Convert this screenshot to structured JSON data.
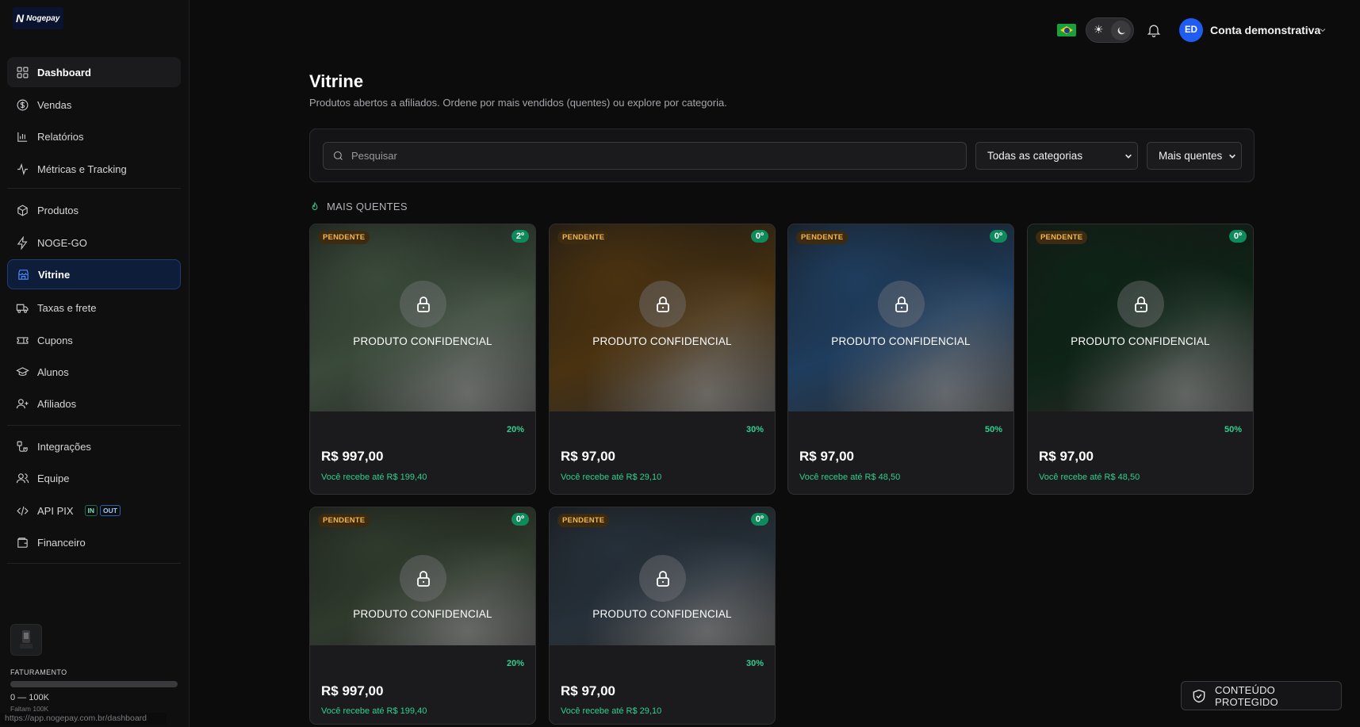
{
  "app": {
    "logo_text": "Nogepay"
  },
  "sidebar": {
    "items": [
      {
        "label": "Dashboard",
        "icon": "grid-icon"
      },
      {
        "label": "Vendas",
        "icon": "dollar-circle-icon"
      },
      {
        "label": "Relatórios",
        "icon": "bar-chart-icon"
      },
      {
        "label": "Métricas e Tracking",
        "icon": "activity-icon"
      },
      {
        "label": "Produtos",
        "icon": "box-icon"
      },
      {
        "label": "NOGE-GO",
        "icon": "zap-icon"
      },
      {
        "label": "Vitrine",
        "icon": "store-icon",
        "active": true
      },
      {
        "label": "Taxas e frete",
        "icon": "truck-icon"
      },
      {
        "label": "Cupons",
        "icon": "ticket-icon"
      },
      {
        "label": "Alunos",
        "icon": "graduation-cap-icon"
      },
      {
        "label": "Afiliados",
        "icon": "user-plus-icon"
      },
      {
        "label": "Integrações",
        "icon": "plug-icon"
      },
      {
        "label": "Equipe",
        "icon": "users-icon"
      },
      {
        "label": "API PIX",
        "icon": "code-icon",
        "pills": [
          "IN",
          "OUT"
        ]
      },
      {
        "label": "Financeiro",
        "icon": "wallet-icon"
      }
    ],
    "billing": {
      "label": "FATURAMENTO",
      "range": "0 — 100K",
      "remaining": "Faltam 100K",
      "progress": 0
    }
  },
  "status_url": "https://app.nogepay.com.br/dashboard",
  "header": {
    "flag": "brazil-flag-icon",
    "theme": "dark",
    "user_initials": "ED",
    "user_name": "Conta demonstrativa"
  },
  "page": {
    "title": "Vitrine",
    "subtitle": "Produtos abertos a afiliados. Ordene por mais vendidos (quentes) ou explore por categoria."
  },
  "filters": {
    "search_placeholder": "Pesquisar",
    "search_value": "",
    "category_selected": "Todas as categorias",
    "sort_selected": "Mais quentes"
  },
  "section": {
    "label": "MAIS QUENTES"
  },
  "products": [
    {
      "status": "PENDENTE",
      "rank": "2º",
      "title": "PRODUTO CONFIDENCIAL",
      "commission": "20%",
      "price": "R$ 997,00",
      "earn": "Você recebe até R$ 199,40",
      "tint": "#3a4a3a"
    },
    {
      "status": "PENDENTE",
      "rank": "0º",
      "title": "PRODUTO CONFIDENCIAL",
      "commission": "30%",
      "price": "R$ 97,00",
      "earn": "Você recebe até R$ 29,10",
      "tint": "#4a3210"
    },
    {
      "status": "PENDENTE",
      "rank": "0º",
      "title": "PRODUTO CONFIDENCIAL",
      "commission": "50%",
      "price": "R$ 97,00",
      "earn": "Você recebe até R$ 48,50",
      "tint": "#1f3d5e"
    },
    {
      "status": "PENDENTE",
      "rank": "0º",
      "title": "PRODUTO CONFIDENCIAL",
      "commission": "50%",
      "price": "R$ 97,00",
      "earn": "Você recebe até R$ 48,50",
      "tint": "#0e2416"
    },
    {
      "status": "PENDENTE",
      "rank": "0º",
      "title": "PRODUTO CONFIDENCIAL",
      "commission": "20%",
      "price": "R$ 997,00",
      "earn": "Você recebe até R$ 199,40",
      "tint": "#2f3a2c"
    },
    {
      "status": "PENDENTE",
      "rank": "0º",
      "title": "PRODUTO CONFIDENCIAL",
      "commission": "30%",
      "price": "R$ 97,00",
      "earn": "Você recebe até R$ 29,10",
      "tint": "#26303a"
    }
  ],
  "protected_label": "CONTEÚDO PROTEGIDO",
  "colors": {
    "accent": "#1f5cf2",
    "success": "#2fd08f",
    "pending": "#f3b648",
    "background": "#0c0c0d"
  }
}
